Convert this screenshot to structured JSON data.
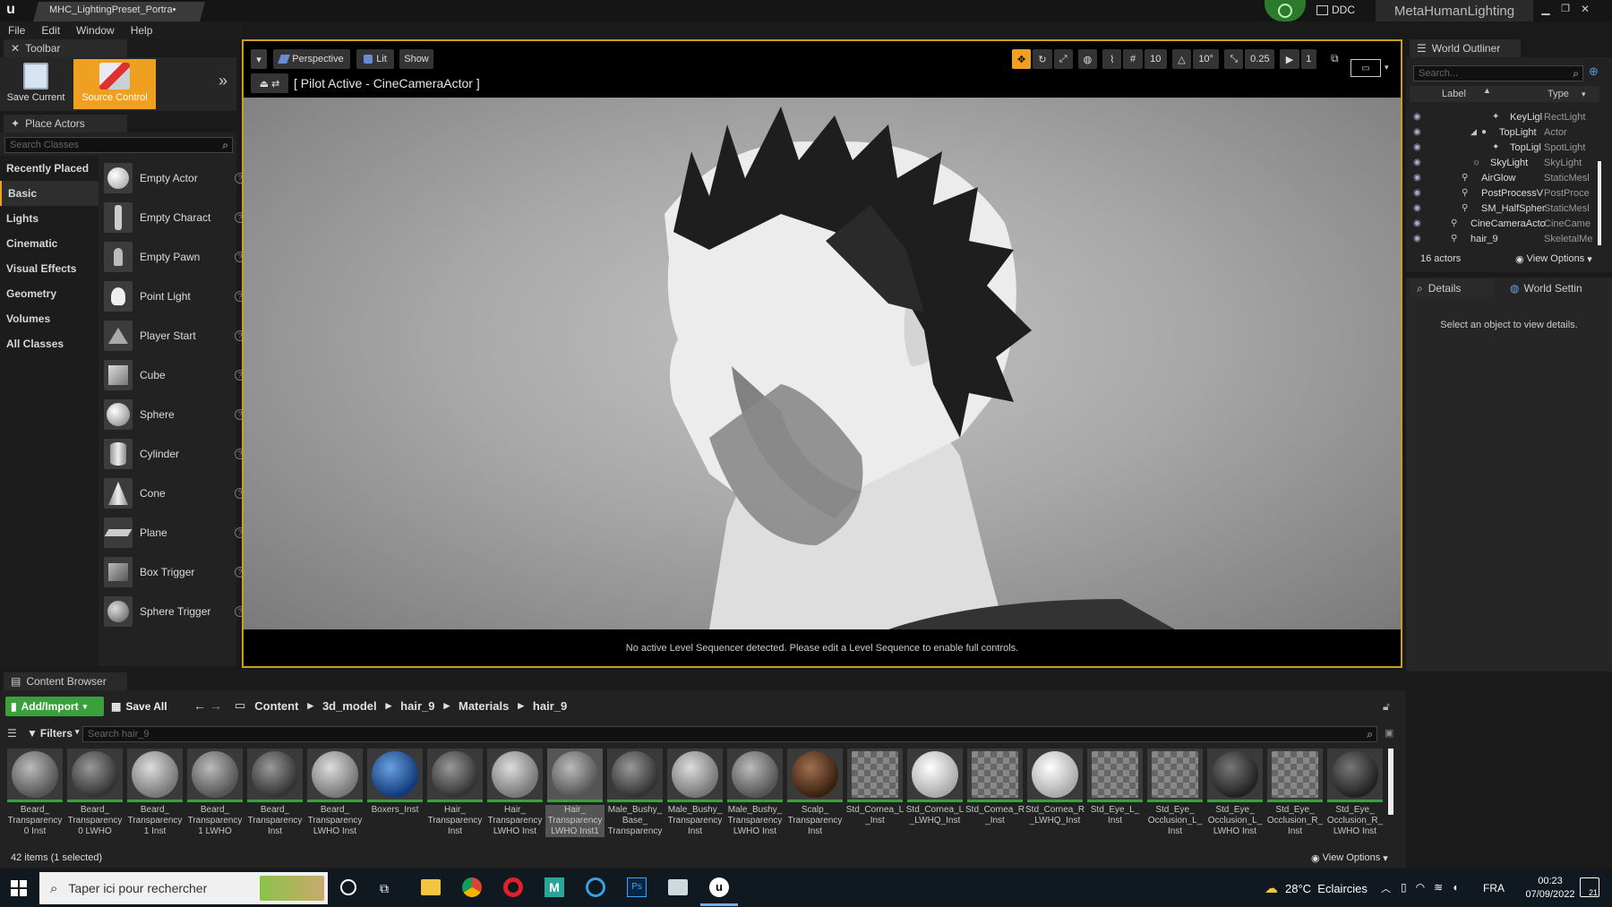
{
  "window": {
    "tab_title": "MHC_LightingPreset_Portra•",
    "ddc_label": "DDC",
    "project_name": "MetaHumanLighting"
  },
  "menu": [
    "File",
    "Edit",
    "Window",
    "Help"
  ],
  "toolbar_panel": {
    "title": "Toolbar",
    "save_label": "Save Current",
    "source_control_label": "Source Control"
  },
  "place_actors": {
    "title": "Place Actors",
    "search_placeholder": "Search Classes",
    "categories": [
      "Recently Placed",
      "Basic",
      "Lights",
      "Cinematic",
      "Visual Effects",
      "Geometry",
      "Volumes",
      "All Classes"
    ],
    "selected_category": "Basic",
    "items": [
      "Empty Actor",
      "Empty Charact",
      "Empty Pawn",
      "Point Light",
      "Player Start",
      "Cube",
      "Sphere",
      "Cylinder",
      "Cone",
      "Plane",
      "Box Trigger",
      "Sphere Trigger"
    ]
  },
  "viewport": {
    "perspective_label": "Perspective",
    "lit_label": "Lit",
    "show_label": "Show",
    "pilot_label": "[ Pilot Active - CineCameraActor ]",
    "grid_snap": "10",
    "angle_snap": "10°",
    "scale_snap": "0.25",
    "camera_speed": "1",
    "sequencer_message": "No active Level Sequencer detected. Please edit a Level Sequence to enable full controls."
  },
  "outliner": {
    "title": "World Outliner",
    "search_placeholder": "Search...",
    "col_label": "Label",
    "col_type": "Type",
    "rows": [
      {
        "label": "KeyLigl",
        "type": "RectLight"
      },
      {
        "label": "TopLight",
        "type": "Actor"
      },
      {
        "label": "TopLigl",
        "type": "SpotLight"
      },
      {
        "label": "SkyLight",
        "type": "SkyLight"
      },
      {
        "label": "AirGlow",
        "type": "StaticMesl"
      },
      {
        "label": "PostProcessV",
        "type": "PostProce"
      },
      {
        "label": "SM_HalfSpher",
        "type": "StaticMesl"
      },
      {
        "label": "CineCameraActo",
        "type": "CineCame"
      },
      {
        "label": "hair_9",
        "type": "SkeletalMe"
      }
    ],
    "count": "16 actors",
    "view_options": "View Options"
  },
  "details": {
    "tab_details": "Details",
    "tab_world": "World Settin",
    "empty_message": "Select an object to view details."
  },
  "content_browser": {
    "title": "Content Browser",
    "add_import": "Add/Import",
    "save_all": "Save All",
    "breadcrumb": [
      "Content",
      "3d_model",
      "hair_9",
      "Materials",
      "hair_9"
    ],
    "filters": "Filters",
    "search_placeholder": "Search hair_9",
    "assets": [
      "Beard_ Transparency 0 Inst",
      "Beard_ Transparency 0 LWHO",
      "Beard_ Transparency 1 Inst",
      "Beard_ Transparency 1 LWHO",
      "Beard_ Transparency Inst",
      "Beard_ Transparency LWHO Inst",
      "Boxers_Inst",
      "Hair_ Transparency Inst",
      "Hair_ Transparency LWHO Inst",
      "Hair_ Transparency LWHO Inst1",
      "Male_Bushy_ Base_ Transparency",
      "Male_Bushy_ Transparency Inst",
      "Male_Bushy_ Transparency LWHO Inst",
      "Scalp_ Transparency Inst",
      "Std_Cornea_L _Inst",
      "Std_Cornea_L _LWHQ_Inst",
      "Std_Cornea_R _Inst",
      "Std_Cornea_R _LWHQ_Inst",
      "Std_Eye_L_ Inst",
      "Std_Eye_ Occlusion_L_ Inst",
      "Std_Eye_ Occlusion_L_ LWHO Inst",
      "Std_Eye_ Occlusion_R_ Inst",
      "Std_Eye_ Occlusion_R_ LWHO Inst"
    ],
    "status": "42 items (1 selected)",
    "view_options": "View Options"
  },
  "taskbar": {
    "search_placeholder": "Taper ici pour rechercher",
    "weather": "28°C  Eclaircies",
    "lang": "FRA",
    "time": "00:23",
    "date": "07/09/2022",
    "notif_count": "21"
  },
  "colors": {
    "accent_orange": "#f0a020",
    "accent_green": "#3aa13a",
    "viewport_border": "#c8a020"
  }
}
